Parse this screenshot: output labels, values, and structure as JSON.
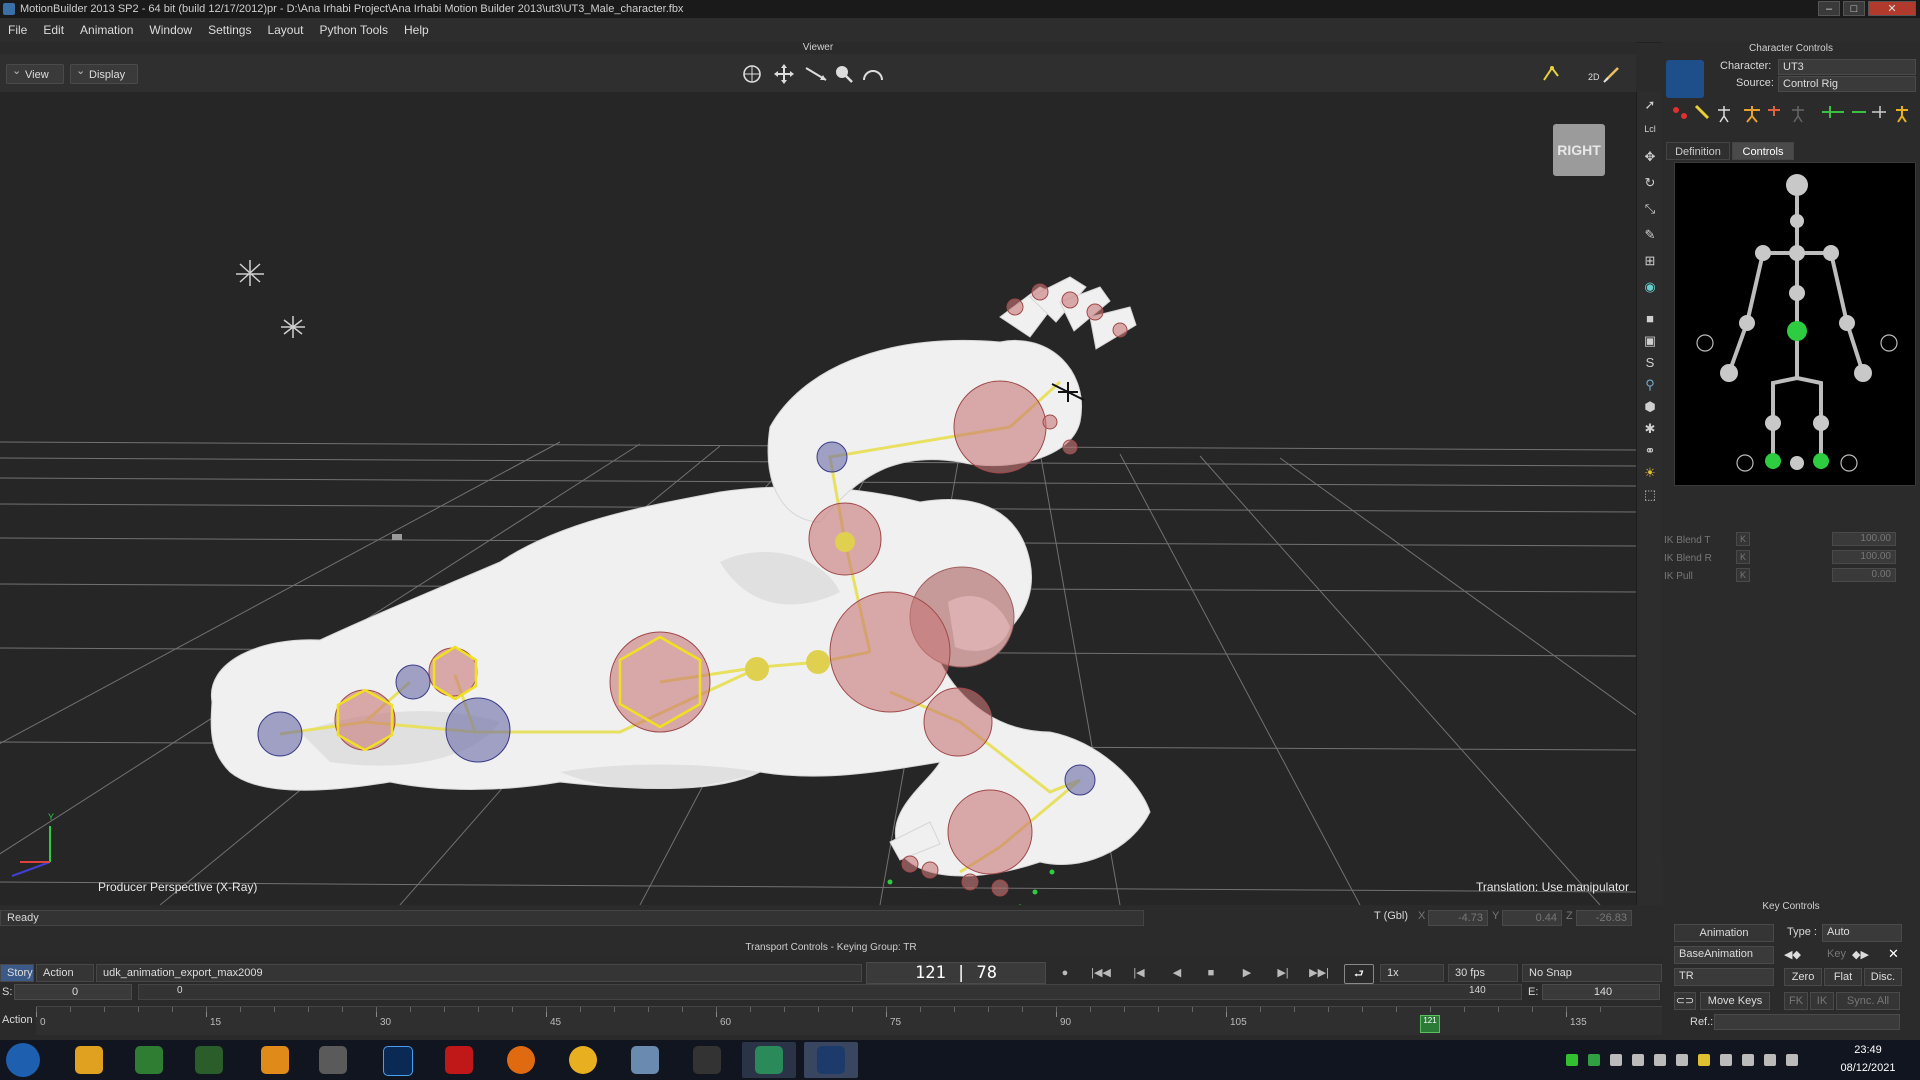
{
  "window": {
    "title": "MotionBuilder 2013 SP2  - 64 bit (build 12/17/2012)pr  - D:\\Ana Irhabi Project\\Ana Irhabi Motion Builder 2013\\ut3\\UT3_Male_character.fbx"
  },
  "menu": [
    "File",
    "Edit",
    "Animation",
    "Window",
    "Settings",
    "Layout",
    "Python Tools",
    "Help"
  ],
  "viewer": {
    "header": "Viewer",
    "view_label": "View",
    "display_label": "Display",
    "camera_label": "Producer Perspective (X-Ray)",
    "manipulator_label": "Translation: Use manipulator",
    "cube_label": "RIGHT",
    "axis_y": "Y",
    "toolbar_2d": "2D"
  },
  "status": {
    "ready": "Ready",
    "t_label": "T (Gbl)",
    "x_label": "X",
    "y_label": "Y",
    "z_label": "Z",
    "x_value": "-4.73",
    "y_value": "0.44",
    "z_value": "-26.83"
  },
  "character_controls": {
    "header": "Character Controls",
    "character_label": "Character:",
    "character_value": "UT3",
    "source_label": "Source:",
    "source_value": "Control Rig",
    "tabs": [
      "Definition",
      "Controls"
    ],
    "active_tab": "Controls",
    "ik": [
      {
        "label": "IK Blend T",
        "key": "K",
        "value": "100.00"
      },
      {
        "label": "IK Blend R",
        "key": "K",
        "value": "100.00"
      },
      {
        "label": "IK Pull",
        "key": "K",
        "value": "0.00"
      }
    ]
  },
  "key_controls": {
    "header": "Key Controls",
    "mode": "Animation",
    "type_label": "Type :",
    "type_value": "Auto",
    "layer": "BaseAnimation",
    "key_label": "Key",
    "channel": "TR",
    "zero": "Zero",
    "flat": "Flat",
    "disc": "Disc.",
    "move_keys": "Move Keys",
    "fk": "FK",
    "ik": "IK",
    "sync_all": "Sync. All",
    "ref_label": "Ref.:"
  },
  "transport": {
    "header": "Transport Controls  -  Keying Group: TR",
    "story": "Story",
    "action": "Action",
    "take": "udk_animation_export_max2009",
    "frame_display": "121 | 78",
    "speed": "1x",
    "fps": "30 fps",
    "snap": "No Snap",
    "s_label": "S:",
    "s_value": "0",
    "s_marker": "0",
    "end_marker": "140",
    "e_label": "E:",
    "e_value": "140",
    "timeline_label": "Action",
    "ticks": [
      "0",
      "15",
      "30",
      "45",
      "60",
      "75",
      "90",
      "105",
      "135"
    ],
    "current_frame": "121"
  },
  "taskbar": {
    "time": "23:49",
    "date": "08/12/2021",
    "apps": [
      "start-orb",
      "weather",
      "excel-like",
      "terminal",
      "sublime",
      "tools",
      "photoshop",
      "filezilla",
      "firefox",
      "chrome",
      "network",
      "video-editor",
      "app-green",
      "motionbuilder"
    ]
  },
  "colors": {
    "viewport_bg": "#262626",
    "grid": "#8a8a8a",
    "bone_yellow": "#e8e060",
    "joint_red": "#c87878",
    "joint_blue": "#6a6aa8",
    "skin": "#f2f2f2",
    "rig_green": "#2ecc40"
  }
}
